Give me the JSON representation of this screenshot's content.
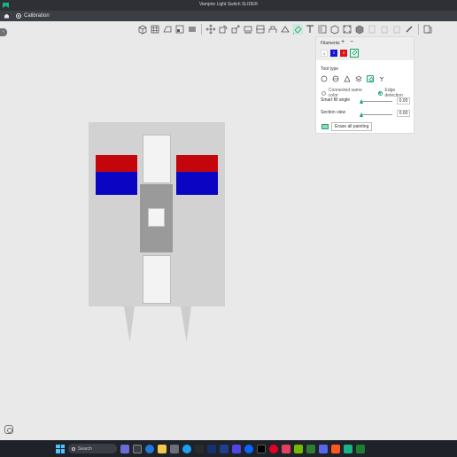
{
  "window": {
    "title": "Vampire Light Switch SLIDER"
  },
  "tabs": [
    {
      "label": "Calibration"
    }
  ],
  "toolbar": {
    "icons": [
      "add-icon",
      "grid-icon",
      "auto-orient-icon",
      "arrange-icon",
      "layers-icon",
      "move-icon",
      "rotate-icon",
      "scale-icon",
      "lay-on-face-icon",
      "cut-icon",
      "support-paint-icon",
      "seam-paint-icon",
      "color-paint-icon",
      "text-icon",
      "measure-icon",
      "assembly-icon",
      "split-objects-icon",
      "split-parts-icon",
      "variable-layer-icon",
      "copy-icon",
      "paste-icon",
      "delete-icon",
      "erase-icon",
      "more-icon"
    ]
  },
  "side_tab": {
    "label": "‹"
  },
  "panel": {
    "filaments_label": "Filaments",
    "add_label": "+",
    "remove_label": "−",
    "filaments": [
      {
        "num": "1",
        "color": "#ffffff"
      },
      {
        "num": "2",
        "color": "#1912d1"
      },
      {
        "num": "3",
        "color": "#d7141a"
      }
    ],
    "tool_type_label": "Tool type",
    "tools": [
      "circle-tool-icon",
      "sphere-tool-icon",
      "triangle-tool-icon",
      "height-range-tool-icon",
      "fill-tool-icon",
      "gap-fill-tool-icon"
    ],
    "connected_label": "Connected same color",
    "edge_label": "Edge detection",
    "smart_fill_label": "Smart fill angle",
    "smart_fill_value": "0.00",
    "section_label": "Section view",
    "section_value": "0.00",
    "erase_label": "Erase all painting"
  },
  "taskbar": {
    "search_placeholder": "Search"
  }
}
